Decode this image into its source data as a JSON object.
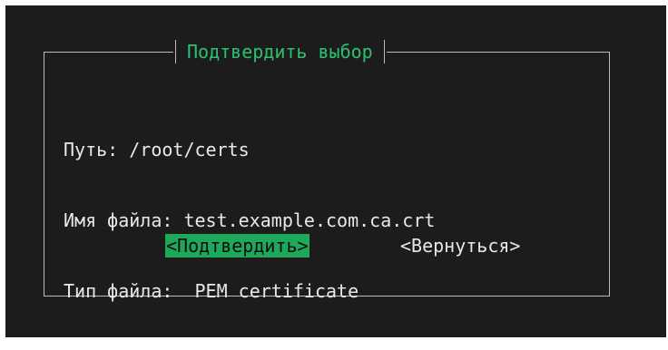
{
  "dialog": {
    "title": "Подтвердить выбор",
    "lines": [
      "Путь: /root/certs",
      "Имя файла: test.example.com.ca.crt",
      "Тип файла:  PEM certificate"
    ],
    "buttons": {
      "confirm": "<Подтвердить>",
      "back": "<Вернуться>"
    }
  },
  "colors": {
    "background": "#1c1c1c",
    "title": "#2bc070",
    "selected_button": "#1ea85a",
    "frame": "#bdbdbd"
  }
}
